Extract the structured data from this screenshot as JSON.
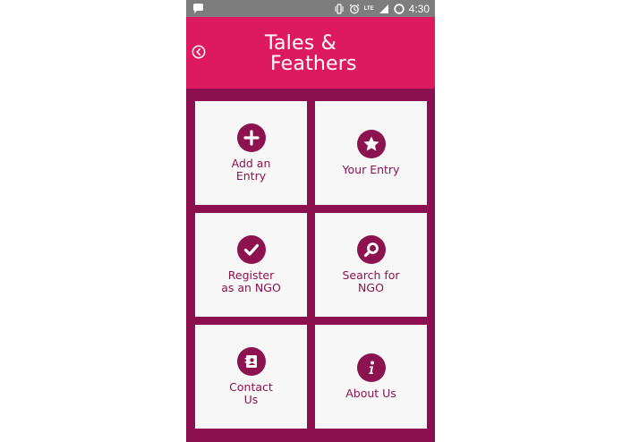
{
  "status_bar": {
    "time": "4:30",
    "network_label": "LTE",
    "icons": [
      "notification-bubble-icon",
      "vibrate-icon",
      "alarm-icon",
      "signal-icon",
      "battery-icon"
    ]
  },
  "header": {
    "title_line1": "Tales &",
    "title_line2": "Feathers",
    "back_icon": "back-circle-icon",
    "background_color": "#de1a5f"
  },
  "grid": {
    "background_color": "#8c0f4f",
    "tiles": [
      {
        "label": "Add an\nEntry",
        "icon": "plus-circle-icon"
      },
      {
        "label": "Your Entry",
        "icon": "star-circle-icon"
      },
      {
        "label": "Register\nas an NGO",
        "icon": "check-circle-icon"
      },
      {
        "label": "Search for\nNGO",
        "icon": "search-circle-icon"
      },
      {
        "label": "Contact\nUs",
        "icon": "contact-book-icon"
      },
      {
        "label": "About Us",
        "icon": "info-circle-icon"
      }
    ]
  },
  "colors": {
    "accent": "#8c1250",
    "tile_background": "#f7f7f7",
    "status_bar": "#7d7d7d"
  }
}
